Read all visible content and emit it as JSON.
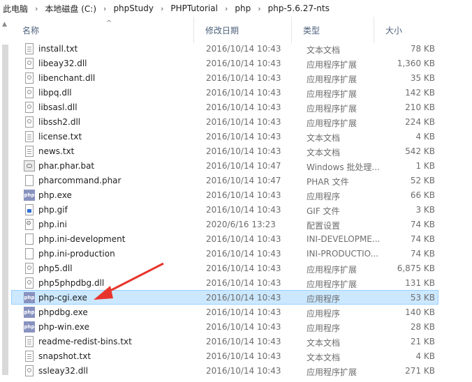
{
  "breadcrumb": [
    "此电脑",
    "本地磁盘 (C:)",
    "phpStudy",
    "PHPTutorial",
    "php",
    "php-5.6.27-nts"
  ],
  "columns": {
    "name": "名称",
    "date": "修改日期",
    "type": "类型",
    "size": "大小"
  },
  "files": [
    {
      "name": "install.txt",
      "date": "2016/10/14 10:43",
      "type": "文本文档",
      "size": "78 KB",
      "icon": "text-file-icon"
    },
    {
      "name": "libeay32.dll",
      "date": "2016/10/14 10:43",
      "type": "应用程序扩展",
      "size": "1,360 KB",
      "icon": "dll-file-icon"
    },
    {
      "name": "libenchant.dll",
      "date": "2016/10/14 10:43",
      "type": "应用程序扩展",
      "size": "35 KB",
      "icon": "dll-file-icon"
    },
    {
      "name": "libpq.dll",
      "date": "2016/10/14 10:43",
      "type": "应用程序扩展",
      "size": "142 KB",
      "icon": "dll-file-icon"
    },
    {
      "name": "libsasl.dll",
      "date": "2016/10/14 10:43",
      "type": "应用程序扩展",
      "size": "210 KB",
      "icon": "dll-file-icon"
    },
    {
      "name": "libssh2.dll",
      "date": "2016/10/14 10:43",
      "type": "应用程序扩展",
      "size": "224 KB",
      "icon": "dll-file-icon"
    },
    {
      "name": "license.txt",
      "date": "2016/10/14 10:43",
      "type": "文本文档",
      "size": "4 KB",
      "icon": "text-file-icon"
    },
    {
      "name": "news.txt",
      "date": "2016/10/14 10:43",
      "type": "文本文档",
      "size": "542 KB",
      "icon": "text-file-icon"
    },
    {
      "name": "phar.phar.bat",
      "date": "2016/10/14 10:47",
      "type": "Windows 批处理...",
      "size": "1 KB",
      "icon": "batch-file-icon"
    },
    {
      "name": "pharcommand.phar",
      "date": "2016/10/14 10:47",
      "type": "PHAR 文件",
      "size": "52 KB",
      "icon": "blank-file-icon"
    },
    {
      "name": "php.exe",
      "date": "2016/10/14 10:43",
      "type": "应用程序",
      "size": "66 KB",
      "icon": "php-exe-icon"
    },
    {
      "name": "php.gif",
      "date": "2016/10/14 10:43",
      "type": "GIF 文件",
      "size": "3 KB",
      "icon": "gif-file-icon"
    },
    {
      "name": "php.ini",
      "date": "2020/6/16 13:23",
      "type": "配置设置",
      "size": "74 KB",
      "icon": "ini-file-icon"
    },
    {
      "name": "php.ini-development",
      "date": "2016/10/14 10:43",
      "type": "INI-DEVELOPME...",
      "size": "74 KB",
      "icon": "blank-file-icon"
    },
    {
      "name": "php.ini-production",
      "date": "2016/10/14 10:43",
      "type": "INI-PRODUCTIO...",
      "size": "74 KB",
      "icon": "blank-file-icon"
    },
    {
      "name": "php5.dll",
      "date": "2016/10/14 10:43",
      "type": "应用程序扩展",
      "size": "6,875 KB",
      "icon": "dll-file-icon"
    },
    {
      "name": "php5phpdbg.dll",
      "date": "2016/10/14 10:43",
      "type": "应用程序扩展",
      "size": "131 KB",
      "icon": "dll-file-icon"
    },
    {
      "name": "php-cgi.exe",
      "date": "2016/10/14 10:43",
      "type": "应用程序",
      "size": "53 KB",
      "icon": "php-exe-icon",
      "selected": true
    },
    {
      "name": "phpdbg.exe",
      "date": "2016/10/14 10:43",
      "type": "应用程序",
      "size": "140 KB",
      "icon": "php-exe-icon"
    },
    {
      "name": "php-win.exe",
      "date": "2016/10/14 10:43",
      "type": "应用程序",
      "size": "28 KB",
      "icon": "php-exe-icon"
    },
    {
      "name": "readme-redist-bins.txt",
      "date": "2016/10/14 10:43",
      "type": "文本文档",
      "size": "21 KB",
      "icon": "text-file-icon"
    },
    {
      "name": "snapshot.txt",
      "date": "2016/10/14 10:43",
      "type": "文本文档",
      "size": "4 KB",
      "icon": "text-file-icon"
    },
    {
      "name": "ssleay32.dll",
      "date": "2016/10/14 10:43",
      "type": "应用程序扩展",
      "size": "271 KB",
      "icon": "dll-file-icon"
    }
  ],
  "php_icon_text": "php",
  "annotation_color": "#e8352c",
  "selection_color": "#cce8ff"
}
